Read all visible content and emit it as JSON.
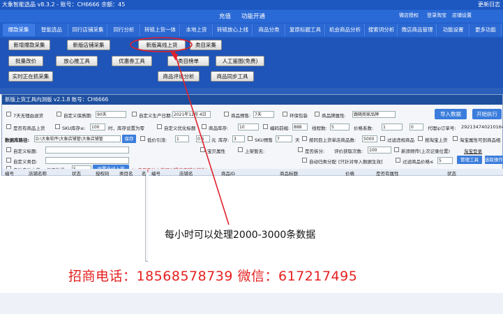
{
  "titlebar": {
    "text": "大象智能选品 v8.3.2 - 账号：CH6666 余额：45",
    "right": "更新日志"
  },
  "menubar": {
    "items": [
      "充值",
      "功能开通"
    ],
    "right": [
      "微店授权",
      "登录淘宝",
      "店铺设置"
    ]
  },
  "tabs": [
    "爆款采集",
    "智能选品",
    "同行店铺采集",
    "同行分析",
    "转链上货一体",
    "本地上货",
    "转链放心上线",
    "商品分类",
    "复原标题工具",
    "机会商品分析",
    "搜索词分析",
    "微店商品管理",
    "功能设置",
    "更多功能"
  ],
  "toolbar": {
    "row1": [
      "新增爆款采集",
      "新版店铺采集",
      "新版离线上货",
      "类目采集"
    ],
    "row2": [
      "批量改价",
      "放心推工具",
      "优惠券工具",
      "类目榜单",
      "人工鉴图(免费)"
    ],
    "row3": [
      "实时正在抓采集",
      "商品评论分析",
      "商品同步工具"
    ]
  },
  "window": {
    "title": "新版上货工具内测版 v2.1.8 账号：CH6666",
    "r1": {
      "auto_gen": "7天无理由退货",
      "custom_date": "自定义保质期:",
      "date_val": "90天",
      "prod_date": "自定义生产日期:",
      "date2": "2021年12月 4日",
      "preview": "商品预售:",
      "preview_val": "7天",
      "env": "环保包装",
      "brand_attr": "商品牌属性:",
      "brand_val": "跟随商家品牌",
      "import_btn": "导入数据",
      "start_btn": "开始执行"
    },
    "r2": {
      "a": "是否有商品上货",
      "b": "SKU库存≤:",
      "b_val": "100",
      "c": "时，库存设置为零",
      "d": "自定义优化标题",
      "e": "商品库存:",
      "e_val": "10",
      "f": "编码前缀:",
      "f_val": "888",
      "g": "线程数:",
      "g_val": "5",
      "h": "价格系数:",
      "h_val": "1",
      "i_val": "0",
      "agent": "代理ip订单号:",
      "agent_val": "292134740210164"
    },
    "r3": {
      "path_lbl": "数据库路径:",
      "path_val": "D:\\大象软件\\大象店铺管\\大象店铺管",
      "save": "保存",
      "low_price": "低价引流:",
      "lp1": "1",
      "lp2": "0.5",
      "lp_unit": "元",
      "stock": "库存:",
      "stock_val": "3",
      "sku_pre": "SKU预售",
      "sku_val": "7",
      "sku_unit": "天",
      "by_shop": "按同目上货单店商品数:",
      "by_shop_val": "5000",
      "filter": "过滤违规商品",
      "by_tb": "按淘宝上货",
      "by_attr": "淘宝属性可到商品相"
    },
    "r4": {
      "custom_title": "自定义标题:",
      "flag": "宝贝属性",
      "ex": "上架暂无:",
      "split": "是否拆分:",
      "quality": "评价获取次数:",
      "quality_val": "100",
      "new_cat": "新添频传(上次记录位置)",
      "refresh": "淘宝登录"
    },
    "r5": {
      "custom_cat": "自定义类目:",
      "auto_split": "自动归类分配",
      "note": "[只针对导入数据生效]",
      "filter_price": "过滤商品价格≤",
      "filter_price_val": "5",
      "manage": "管理工具",
      "task": "选取操作"
    },
    "r6": {
      "auto": "启动自动上货",
      "per_day": "每天数量:",
      "per_val": "5",
      "set_btn": "设置自动上货",
      "hint": "(★启用自动上货可以提高店铺动销数)"
    },
    "left_cols": [
      "编号",
      "店铺名称",
      "状态",
      "授权码",
      "类目名",
      "名"
    ],
    "right_cols": [
      "编号",
      "店铺名",
      "商品ID",
      "商品标题",
      "价格",
      "是否有属性",
      "状态"
    ]
  },
  "note": "每小时可以处理2000-3000条数据",
  "contact": "招商电话：18568578739  微信：617217495",
  "colors": {
    "accent": "#2360cc",
    "contact": "#e51f1f",
    "circle": "#e0202a"
  }
}
